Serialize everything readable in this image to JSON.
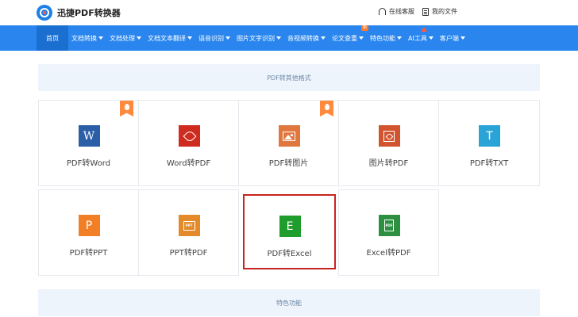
{
  "app": {
    "logo_text": "迅捷PDF转换器"
  },
  "top_links": {
    "support": "在线客服",
    "my_files": "我的文件"
  },
  "nav": {
    "items": [
      {
        "label": "首页",
        "dropdown": false
      },
      {
        "label": "文档转换",
        "dropdown": true
      },
      {
        "label": "文档处理",
        "dropdown": true
      },
      {
        "label": "文档文本翻译",
        "dropdown": true
      },
      {
        "label": "语音识别",
        "dropdown": true
      },
      {
        "label": "图片文字识别",
        "dropdown": true
      },
      {
        "label": "音视频转换",
        "dropdown": true
      },
      {
        "label": "论文查重",
        "dropdown": true,
        "badge": "新"
      },
      {
        "label": "特色功能",
        "dropdown": true
      },
      {
        "label": "AI工具",
        "dropdown": true
      },
      {
        "label": "客户端",
        "dropdown": true
      }
    ]
  },
  "sections": {
    "other_formats": "PDF转其他格式",
    "special_features": "特色功能"
  },
  "tools": [
    {
      "label": "PDF转Word",
      "icon": "word-icon",
      "icon_glyph": "W",
      "hot": true
    },
    {
      "label": "Word转PDF",
      "icon": "pdf-acrobat-icon",
      "hot": false
    },
    {
      "label": "PDF转图片",
      "icon": "image-icon",
      "hot": true
    },
    {
      "label": "图片转PDF",
      "icon": "image-to-pdf-icon",
      "hot": false
    },
    {
      "label": "PDF转TXT",
      "icon": "txt-icon",
      "icon_glyph": "T",
      "hot": false
    },
    {
      "label": "PDF转PPT",
      "icon": "ppt-icon",
      "icon_glyph": "P",
      "hot": false
    },
    {
      "label": "PPT转PDF",
      "icon": "ppt-to-pdf-icon",
      "icon_glyph": "PPT",
      "hot": false
    },
    {
      "label": "PDF转Excel",
      "icon": "excel-icon",
      "icon_glyph": "E",
      "hot": false,
      "selected": true
    },
    {
      "label": "Excel转PDF",
      "icon": "excel-to-pdf-icon",
      "icon_glyph": "PDF",
      "hot": false
    }
  ],
  "colors": {
    "nav_bg": "#2a86ee",
    "nav_active": "#1a6fd0",
    "section_bg": "#eef4fb",
    "selected_border": "#c8241e",
    "hot_badge": "#ff8a3d"
  }
}
